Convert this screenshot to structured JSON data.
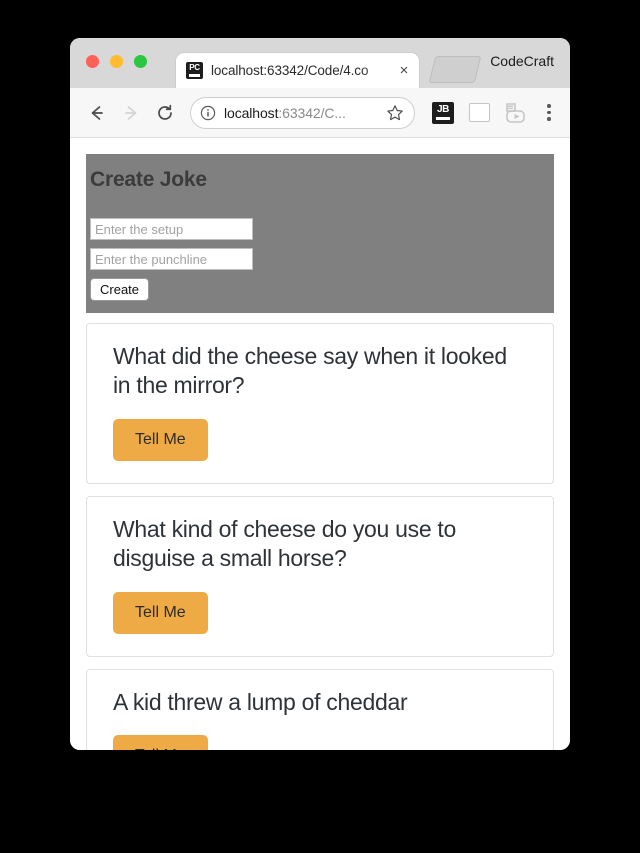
{
  "browser": {
    "traffic_lights": [
      {
        "name": "close",
        "color": "#ff5f57"
      },
      {
        "name": "minimize",
        "color": "#febc2e"
      },
      {
        "name": "maximize",
        "color": "#29c840"
      }
    ],
    "tab": {
      "favicon_label": "PC",
      "title": "localhost:63342/Code/4.co",
      "close_label": "×"
    },
    "window_label": "CodeCraft",
    "toolbar": {
      "back_icon": "arrow-left-icon",
      "forward_icon": "arrow-right-icon",
      "reload_icon": "reload-icon",
      "info_icon": "info-circle-icon",
      "url_secure_part": "localhost",
      "url_rest": ":63342/C...",
      "url_full": "localhost:63342/C...",
      "star_icon": "star-icon",
      "extension_jb_label": "JB",
      "extension_blank_name": "blank-extension-icon",
      "extension_gray_name": "video-download-extension-icon",
      "menu_icon": "three-dot-menu-icon"
    }
  },
  "page": {
    "create_panel": {
      "title": "Create Joke",
      "setup_placeholder": "Enter the setup",
      "setup_value": "",
      "punchline_placeholder": "Enter the punchline",
      "punchline_value": "",
      "create_button": "Create",
      "background_color": "#808080"
    },
    "jokes": [
      {
        "setup": "What did the cheese say when it looked in the mirror?",
        "button_label": "Tell Me"
      },
      {
        "setup": "What kind of cheese do you use to disguise a small horse?",
        "button_label": "Tell Me"
      },
      {
        "setup": "A kid threw a lump of cheddar",
        "button_label": "Tell Me"
      }
    ],
    "accent_color": "#eeaa44"
  }
}
